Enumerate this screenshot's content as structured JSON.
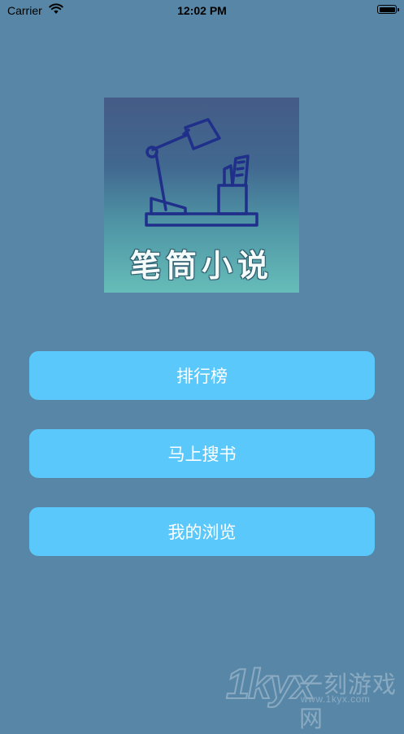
{
  "status_bar": {
    "carrier": "Carrier",
    "time": "12:02 PM",
    "wifi_icon": "wifi-icon",
    "battery_icon": "battery-icon"
  },
  "logo": {
    "title": "笔筒小说",
    "icon": "desk-lamp-icon"
  },
  "menu": {
    "rank_label": "排行榜",
    "search_label": "马上搜书",
    "history_label": "我的浏览"
  },
  "watermark": {
    "logo_text": "1kyx",
    "title": "一刻游戏网",
    "url": "www.1kyx.com"
  },
  "colors": {
    "background": "#5886a6",
    "button": "#5ac8fb",
    "button_text": "#ffffff",
    "logo_line": "#1f2f8a"
  }
}
